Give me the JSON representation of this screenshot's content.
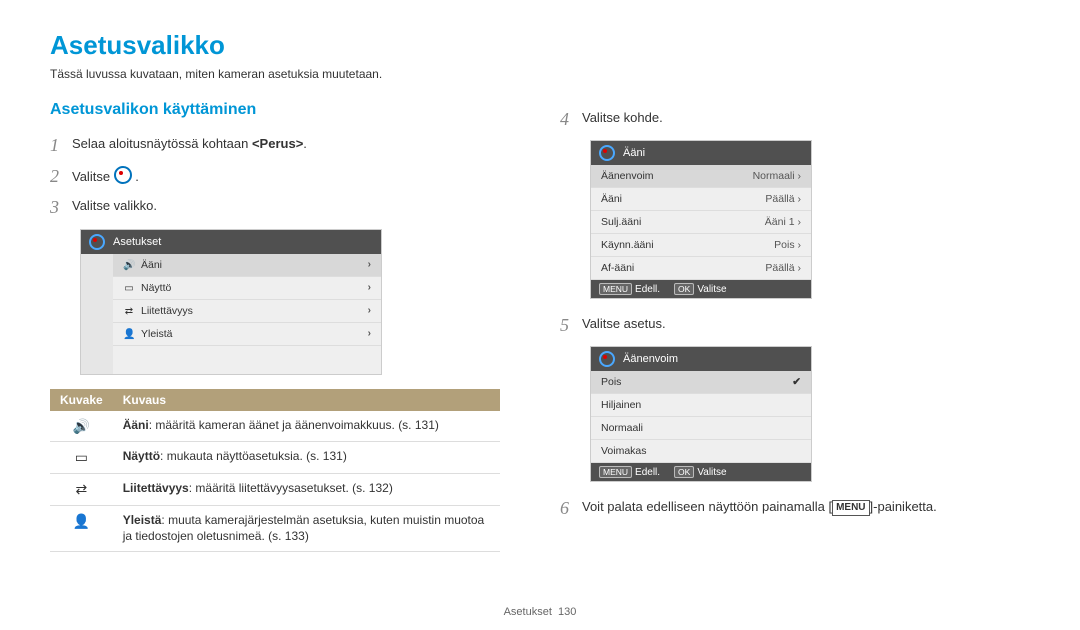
{
  "page": {
    "title": "Asetusvalikko",
    "intro": "Tässä luvussa kuvataan, miten kameran asetuksia muutetaan.",
    "subhead": "Asetusvalikon käyttäminen",
    "footer_section": "Asetukset",
    "footer_page": "130"
  },
  "steps": {
    "s1a": "Selaa aloitusnäytössä kohtaan ",
    "s1b": "<Perus>",
    "s1c": ".",
    "s2a": "Valitse ",
    "s2b": " .",
    "s3": "Valitse valikko.",
    "s4": "Valitse kohde.",
    "s5": "Valitse asetus.",
    "s6a": "Voit palata edelliseen näyttöön painamalla [",
    "s6b": "]-painiketta.",
    "menu_label": "MENU"
  },
  "shot1": {
    "header": "Asetukset",
    "items": [
      {
        "icon": "🔊",
        "label": "Ääni"
      },
      {
        "icon": "▭",
        "label": "Näyttö"
      },
      {
        "icon": "⇄",
        "label": "Liitettävyys"
      },
      {
        "icon": "👤",
        "label": "Yleistä"
      }
    ]
  },
  "shot2": {
    "header": "Ääni",
    "rows": [
      {
        "k": "Äänenvoim",
        "v": "Normaali",
        "sel": true
      },
      {
        "k": "Ääni",
        "v": "Päällä"
      },
      {
        "k": "Sulj.ääni",
        "v": "Ääni 1"
      },
      {
        "k": "Käynn.ääni",
        "v": "Pois"
      },
      {
        "k": "Af-ääni",
        "v": "Päällä"
      }
    ],
    "foot_back_tag": "MENU",
    "foot_back": "Edell.",
    "foot_ok_tag": "OK",
    "foot_ok": "Valitse"
  },
  "shot3": {
    "header": "Äänenvoim",
    "rows": [
      {
        "k": "Pois",
        "sel": true,
        "check": true
      },
      {
        "k": "Hiljainen"
      },
      {
        "k": "Normaali"
      },
      {
        "k": "Voimakas"
      }
    ],
    "foot_back_tag": "MENU",
    "foot_back": "Edell.",
    "foot_ok_tag": "OK",
    "foot_ok": "Valitse"
  },
  "dtable": {
    "h1": "Kuvake",
    "h2": "Kuvaus",
    "rows": [
      {
        "icon": "🔊",
        "b": "Ääni",
        "t": ": määritä kameran äänet ja äänenvoimakkuus. (s. 131)"
      },
      {
        "icon": "▭",
        "b": "Näyttö",
        "t": ": mukauta näyttöasetuksia. (s. 131)"
      },
      {
        "icon": "⇄",
        "b": "Liitettävyys",
        "t": ": määritä liitettävyysasetukset. (s. 132)"
      },
      {
        "icon": "👤",
        "b": "Yleistä",
        "t": ": muuta kamerajärjestelmän asetuksia, kuten muistin muotoa ja tiedostojen oletusnimeä. (s. 133)"
      }
    ]
  }
}
